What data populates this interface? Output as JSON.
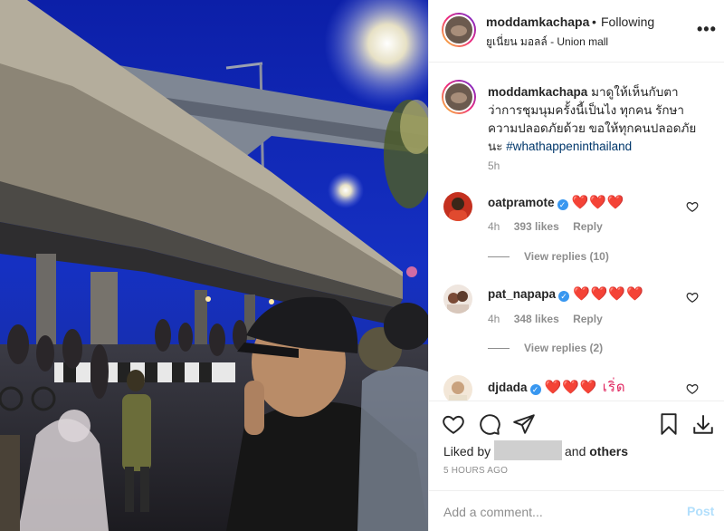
{
  "photo": {
    "alt": "Night street scene under an elevated expressway with crowd"
  },
  "header": {
    "username": "moddamkachapa",
    "separator": "•",
    "follow_label": "Following",
    "location": "ยูเนี่ยน มอลล์ - Union mall",
    "more": "•••"
  },
  "caption": {
    "username": "moddamkachapa",
    "text": "มาดูให้เห็นกับตา ว่าการชุมนุมครั้งนี้เป็นไง ทุกคน รักษาความปลอดภัยด้วย ขอให้ทุกคนปลอดภัยนะ",
    "hashtag": "#whathappeninthailand",
    "time": "5h"
  },
  "comments": [
    {
      "username": "oatpramote",
      "text": "❤️❤️❤️",
      "time": "4h",
      "likes": "393 likes",
      "reply": "Reply",
      "view_replies": "View replies (10)"
    },
    {
      "username": "pat_napapa",
      "text": "❤️❤️❤️❤️",
      "time": "4h",
      "likes": "348 likes",
      "reply": "Reply",
      "view_replies": "View replies (2)"
    },
    {
      "username": "djdada",
      "text": "❤️❤️❤️ เริ่ด",
      "time": "",
      "likes": "",
      "reply": "",
      "view_replies": ""
    }
  ],
  "actions": {
    "liked_by": "Liked by",
    "and_label": "and",
    "others": "others",
    "time": "5 HOURS AGO"
  },
  "add_comment": {
    "placeholder": "Add a comment...",
    "post_label": "Post"
  },
  "colors": {
    "verified": "#3897f0",
    "heart": "#ed4956",
    "link": "#00376b",
    "muted": "#8e8e8e"
  }
}
